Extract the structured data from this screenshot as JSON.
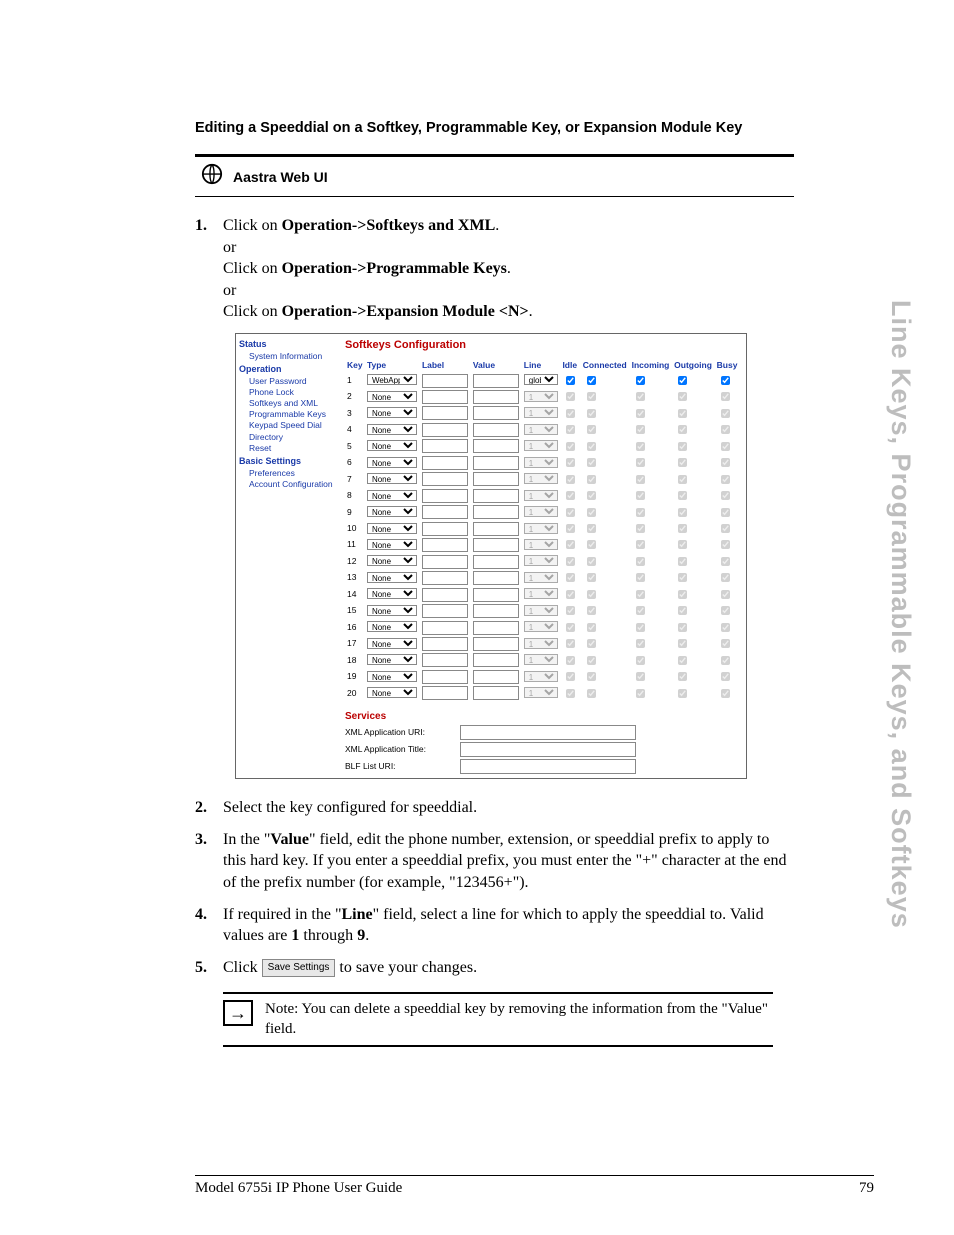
{
  "heading": "Editing a Speeddial on a Softkey, Programmable Key, or Expansion Module Key",
  "aastra_label": "Aastra Web UI",
  "step1": {
    "a": "Click on ",
    "a_bold": "Operation->Softkeys and XML",
    "a_end": ".",
    "or1": "or",
    "b": "Click on ",
    "b_bold": "Operation->Programmable Keys",
    "b_end": ".",
    "or2": "or",
    "c": "Click on ",
    "c_bold": "Operation->Expansion Module <N>",
    "c_end": "."
  },
  "screenshot": {
    "nav": {
      "status": "Status",
      "sysinfo": "System Information",
      "operation": "Operation",
      "items_op": [
        "User Password",
        "Phone Lock",
        "Softkeys and XML",
        "Programmable Keys",
        "Keypad Speed Dial",
        "Directory",
        "Reset"
      ],
      "basic": "Basic Settings",
      "items_bs": [
        "Preferences",
        "Account Configuration"
      ]
    },
    "title": "Softkeys Configuration",
    "cols": [
      "Key",
      "Type",
      "Label",
      "Value",
      "Line",
      "Idle",
      "Connected",
      "Incoming",
      "Outgoing",
      "Busy"
    ],
    "type1": "WebApps",
    "type_none": "None",
    "line1": "global",
    "line_default": "1",
    "services_hdr": "Services",
    "svc": [
      {
        "label": "XML Application URI:"
      },
      {
        "label": "XML Application Title:"
      },
      {
        "label": "BLF List URI:"
      }
    ]
  },
  "step2": "Select the key configured for speeddial.",
  "step3": {
    "a": "In the \"",
    "b": "Value",
    "c": "\" field, edit the phone number, extension, or speeddial prefix to apply to this hard key. If you enter a speeddial prefix, you must enter the \"+\" character at the end of the prefix number (for example, \"123456+\")."
  },
  "step4": {
    "a": "If required in the \"",
    "b": "Line",
    "c": "\" field, select a line for which to apply the speeddial to. Valid values are ",
    "d": "1",
    "e": " through ",
    "f": "9",
    "g": "."
  },
  "step5": {
    "a": "Click ",
    "btn": "Save Settings",
    "b": " to save your changes."
  },
  "note": {
    "a": "Note:",
    "b": " You can delete a speeddial key by removing the information from the \"",
    "c": "Value",
    "d": "\" field."
  },
  "side_tab": "Line Keys, Programmable Keys, and Softkeys",
  "footer": {
    "left": "Model 6755i IP Phone User Guide",
    "right": "79"
  }
}
